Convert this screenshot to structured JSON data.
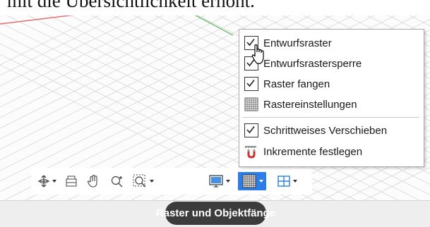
{
  "caption_text": "mit die Übersichtlichkeit erhöht.",
  "menu": {
    "items": [
      {
        "label": "Entwurfsraster",
        "checked": true,
        "icon": "checkbox"
      },
      {
        "label": "Entwurfsrastersperre",
        "checked": true,
        "icon": "checkbox"
      },
      {
        "label": "Raster fangen",
        "checked": true,
        "icon": "checkbox"
      },
      {
        "label": "Rastereinstellungen",
        "icon": "grid-settings-icon"
      },
      {
        "label": "Schrittweises Verschieben",
        "checked": true,
        "icon": "checkbox"
      },
      {
        "label": "Inkremente festlegen",
        "icon": "magnet-increment-icon"
      }
    ]
  },
  "navbar": {
    "tools": [
      "orbit-icon",
      "lookat-icon",
      "pan-icon",
      "zoom-icon",
      "zoom-window-icon",
      "display-icon",
      "grid-icon",
      "viewport-icon"
    ],
    "active_tool": "grid-icon"
  },
  "tooltip": {
    "text": "Raster und Objektfänge"
  },
  "colors": {
    "accent": "#2b7de9",
    "tooltip_bg": "#3c3c3c",
    "grid_line": "#d9d9d9",
    "axis_red": "#e07070",
    "axis_green": "#70c070"
  }
}
